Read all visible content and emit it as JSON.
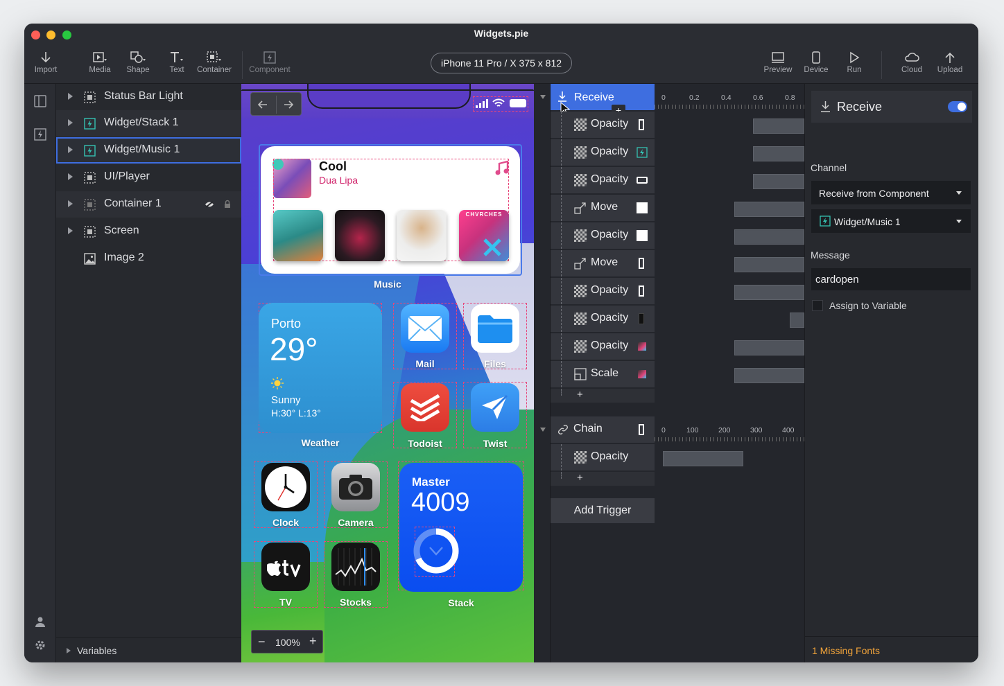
{
  "window": {
    "title": "Widgets.pie",
    "colors": {
      "close": "#ff5f57",
      "minimize": "#febc2e",
      "maximize": "#28c840"
    }
  },
  "toolbar": {
    "left": [
      {
        "label": "Import",
        "icon": "import-icon"
      },
      {
        "label": "Media",
        "icon": "media-icon"
      },
      {
        "label": "Shape",
        "icon": "shape-icon"
      },
      {
        "label": "Text",
        "icon": "text-icon"
      },
      {
        "label": "Container",
        "icon": "container-icon"
      },
      {
        "label": "Component",
        "icon": "component-icon"
      }
    ],
    "device": "iPhone 11 Pro / X  375 x 812",
    "right": [
      {
        "label": "Preview",
        "icon": "preview-icon"
      },
      {
        "label": "Device",
        "icon": "device-icon"
      },
      {
        "label": "Run",
        "icon": "run-icon"
      },
      {
        "label": "Cloud",
        "icon": "cloud-icon"
      },
      {
        "label": "Upload",
        "icon": "upload-icon"
      }
    ]
  },
  "layers": {
    "items": [
      {
        "label": "Status Bar Light",
        "icon": "container-icon"
      },
      {
        "label": "Widget/Stack 1",
        "icon": "component-icon"
      },
      {
        "label": "Widget/Music 1",
        "icon": "component-icon"
      },
      {
        "label": "UI/Player",
        "icon": "container-icon"
      },
      {
        "label": "Container 1",
        "icon": "container-icon"
      },
      {
        "label": "Screen",
        "icon": "container-icon"
      },
      {
        "label": "Image 2",
        "icon": "image-icon"
      }
    ],
    "selected": "Widget/Music 1",
    "footer": "Variables"
  },
  "canvas": {
    "zoom": "100%",
    "music": {
      "song": "Cool",
      "artist": "Dua Lipa",
      "label": "Music",
      "album_text": "CHVRCHES"
    },
    "weather": {
      "city": "Porto",
      "temp": "29°",
      "cond": "Sunny",
      "range": "H:30° L:13°",
      "label": "Weather"
    },
    "apps": {
      "mail": "Mail",
      "files": "Files",
      "todoist": "Todoist",
      "twist": "Twist",
      "clock": "Clock",
      "camera": "Camera",
      "tv": "TV",
      "stocks": "Stocks",
      "stack": "Stack"
    },
    "master": {
      "title": "Master",
      "value": "4009"
    }
  },
  "timeline": {
    "receive": "Receive",
    "ruler1": [
      "0",
      "0.2",
      "0.4",
      "0.6",
      "0.8"
    ],
    "actions": [
      {
        "label": "Opacity",
        "icon": "opacity-icon"
      },
      {
        "label": "Opacity",
        "icon": "opacity-icon"
      },
      {
        "label": "Opacity",
        "icon": "opacity-icon"
      },
      {
        "label": "Move",
        "icon": "move-icon"
      },
      {
        "label": "Opacity",
        "icon": "opacity-icon"
      },
      {
        "label": "Move",
        "icon": "move-icon"
      },
      {
        "label": "Opacity",
        "icon": "opacity-icon"
      },
      {
        "label": "Opacity",
        "icon": "opacity-icon"
      },
      {
        "label": "Opacity",
        "icon": "opacity-icon"
      },
      {
        "label": "Scale",
        "icon": "scale-icon"
      }
    ],
    "chain": "Chain",
    "ruler2": [
      "0",
      "100",
      "200",
      "300",
      "400"
    ],
    "chain_actions": [
      {
        "label": "Opacity",
        "icon": "opacity-icon"
      }
    ],
    "add": "+",
    "add_trigger": "Add Trigger"
  },
  "props": {
    "title": "Receive",
    "enabled": true,
    "channel_label": "Channel",
    "channel": "Receive from Component",
    "component": "Widget/Music 1",
    "message_label": "Message",
    "message": "cardopen",
    "assign": "Assign to Variable",
    "footer": "1 Missing Fonts",
    "colors": {
      "accent": "#3e6ee0",
      "warning": "#f0a33a"
    }
  }
}
